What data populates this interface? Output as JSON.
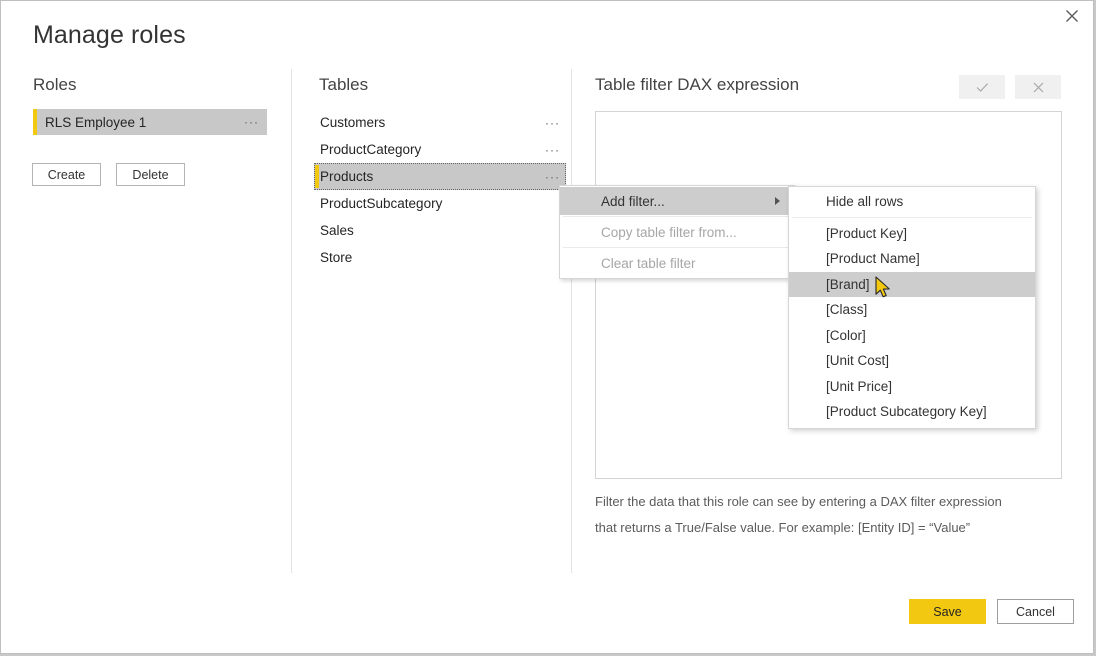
{
  "dialog": {
    "title": "Manage roles",
    "close_icon": "close-icon"
  },
  "roles": {
    "heading": "Roles",
    "items": [
      {
        "label": "RLS Employee 1",
        "selected": true,
        "ellipsis": "···"
      }
    ],
    "create_label": "Create",
    "delete_label": "Delete"
  },
  "tables": {
    "heading": "Tables",
    "ellipsis": "···",
    "items": [
      {
        "label": "Customers",
        "selected": false,
        "has_ellipsis": true
      },
      {
        "label": "ProductCategory",
        "selected": false,
        "has_ellipsis": true
      },
      {
        "label": "Products",
        "selected": true,
        "has_ellipsis": true
      },
      {
        "label": "ProductSubcategory",
        "selected": false,
        "has_ellipsis": false
      },
      {
        "label": "Sales",
        "selected": false,
        "has_ellipsis": false
      },
      {
        "label": "Store",
        "selected": false,
        "has_ellipsis": false
      }
    ]
  },
  "dax": {
    "heading": "Table filter DAX expression",
    "accept_icon": "checkmark-icon",
    "reject_icon": "close-icon",
    "expression_value": "",
    "expression_placeholder": "",
    "help_line_1": "Filter the data that this role can see by entering a DAX filter expression",
    "help_line_2": "that returns a True/False value. For example: [Entity ID] = “Value”"
  },
  "context_menu": {
    "items": [
      {
        "label": "Add filter...",
        "disabled": false,
        "highlighted": true,
        "submenu_arrow": true
      },
      {
        "label": "Copy table filter from...",
        "disabled": true,
        "highlighted": false,
        "submenu_arrow": false
      },
      {
        "label": "Clear table filter",
        "disabled": true,
        "highlighted": false,
        "submenu_arrow": false
      }
    ]
  },
  "submenu": {
    "items": [
      {
        "label": "Hide all rows",
        "highlighted": false
      },
      {
        "label": "[Product Key]",
        "highlighted": false
      },
      {
        "label": "[Product Name]",
        "highlighted": false
      },
      {
        "label": "[Brand]",
        "highlighted": true
      },
      {
        "label": "[Class]",
        "highlighted": false
      },
      {
        "label": "[Color]",
        "highlighted": false
      },
      {
        "label": "[Unit Cost]",
        "highlighted": false
      },
      {
        "label": "[Unit Price]",
        "highlighted": false
      },
      {
        "label": "[Product Subcategory Key]",
        "highlighted": false
      }
    ]
  },
  "footer": {
    "save_label": "Save",
    "cancel_label": "Cancel"
  },
  "colors": {
    "accent_yellow": "#f2c811",
    "selection_gray": "#c8c8c8",
    "menu_highlight": "#cdcdcd",
    "dialog_bg": "#ffffff",
    "page_bg": "#c8c8c8"
  }
}
